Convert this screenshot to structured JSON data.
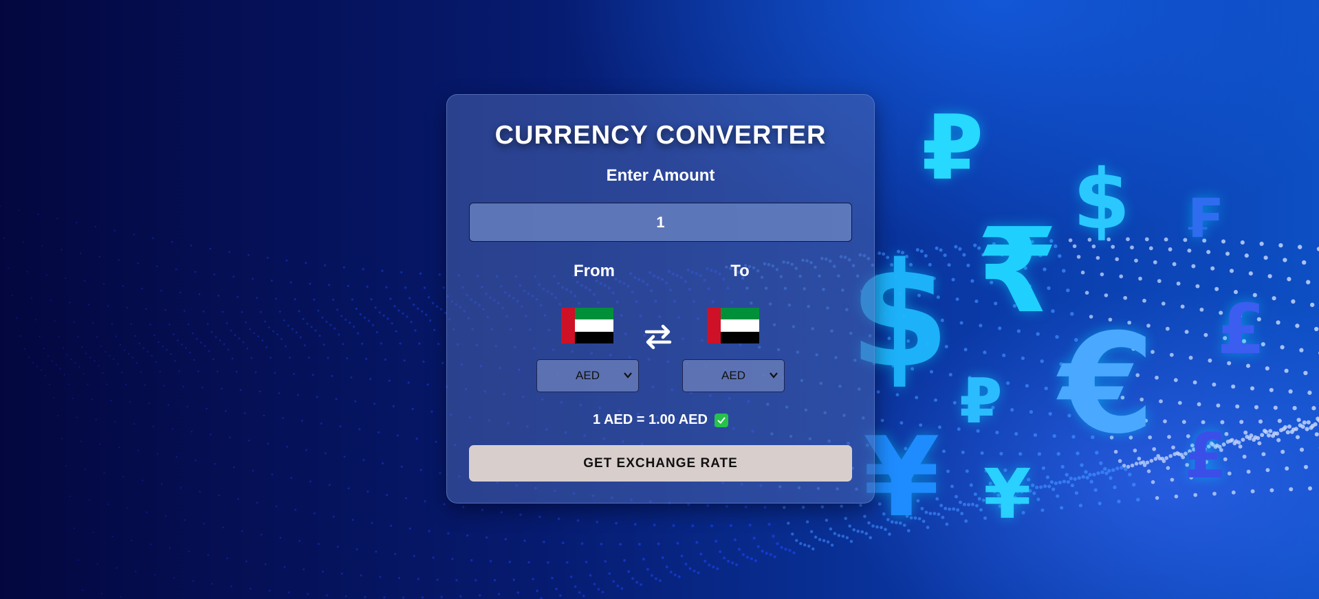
{
  "header": {
    "title": "CURRENCY CONVERTER"
  },
  "amount": {
    "label": "Enter Amount",
    "value": "1"
  },
  "from": {
    "label": "From",
    "currency": "AED",
    "flag_icon": "uae-flag-icon"
  },
  "to": {
    "label": "To",
    "currency": "AED",
    "flag_icon": "uae-flag-icon"
  },
  "swap": {
    "icon": "swap-arrows-icon"
  },
  "result": {
    "text": "1 AED = 1.00 AED",
    "status_icon": "check-icon"
  },
  "action": {
    "button_label": "GET EXCHANGE RATE"
  },
  "background": {
    "symbols": [
      "₽",
      "$",
      "₣",
      "₹",
      "$",
      "£",
      "₽",
      "€",
      "£",
      "¥",
      "¥"
    ]
  },
  "colors": {
    "card": "#4864AF",
    "button": "#D8CFCD",
    "check": "#27C24C",
    "symbol_cyan": "#1FD0FF",
    "symbol_blue": "#3A6CFF"
  }
}
